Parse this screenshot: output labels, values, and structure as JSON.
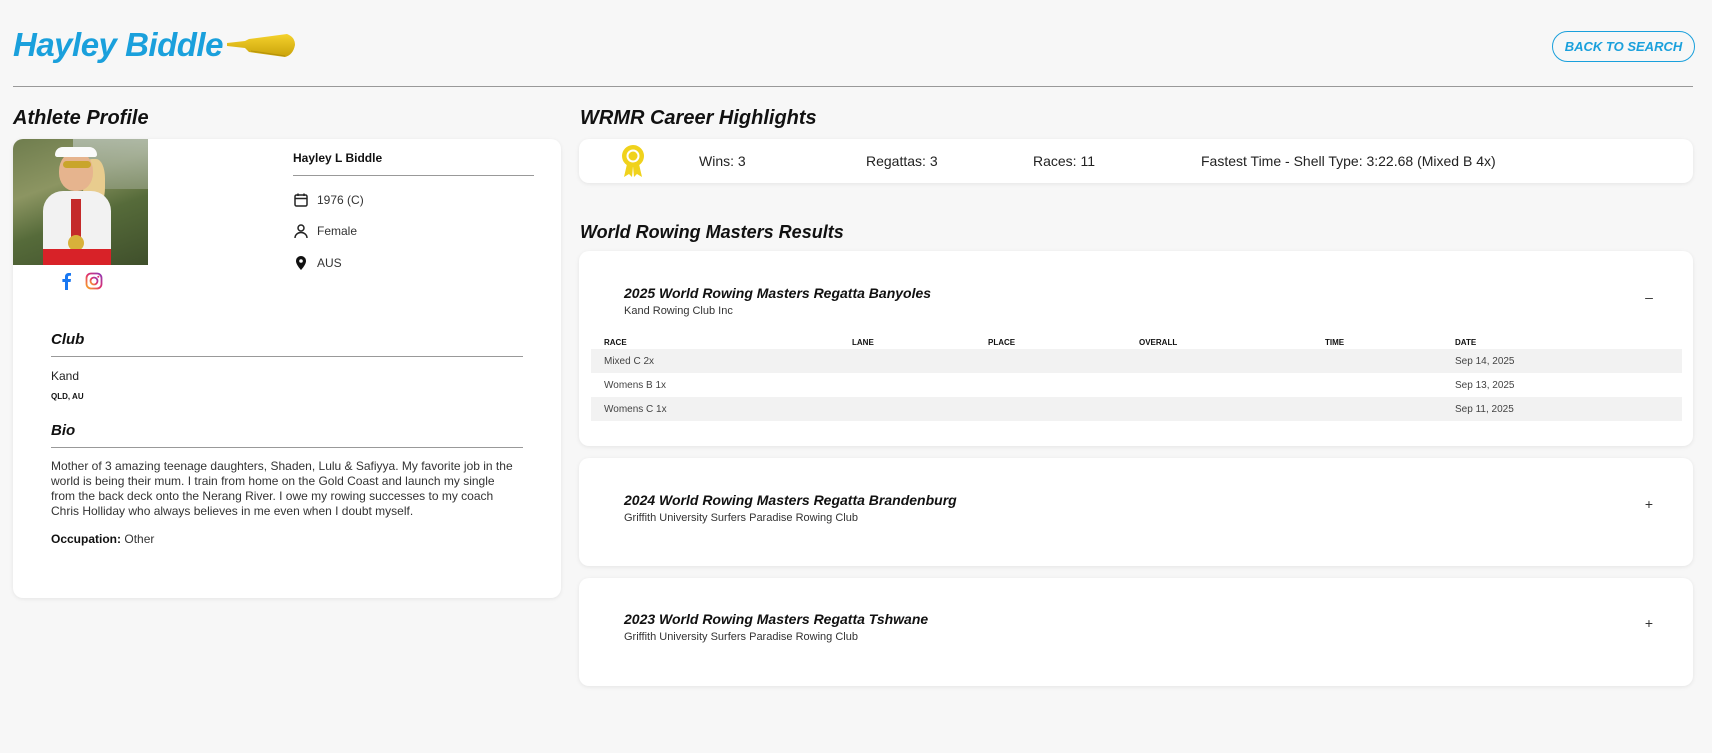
{
  "header": {
    "athlete_name": "Hayley Biddle",
    "back_button": "BACK TO SEARCH",
    "brand_color": "#1aa0dc"
  },
  "profile": {
    "section_title": "Athlete Profile",
    "full_name": "Hayley L Biddle",
    "birth": "1976 (C)",
    "gender": "Female",
    "country": "AUS",
    "icons": [
      "calendar-icon",
      "person-icon",
      "location-pin-icon",
      "facebook-icon",
      "instagram-icon"
    ],
    "club_title": "Club",
    "club_name": "Kand",
    "club_location": "QLD, AU",
    "bio_title": "Bio",
    "bio_text": "Mother of 3 amazing teenage daughters, Shaden, Lulu & Safiyya. My favorite job in the world is being their mum. I train from home on the Gold Coast and launch my single from the back deck onto the Nerang River. I owe my rowing successes to my coach Chris Holliday who always believes in me even when I doubt myself.",
    "occupation_label": "Occupation:",
    "occupation_value": "Other"
  },
  "highlights": {
    "section_title": "WRMR Career Highlights",
    "wins": "Wins:  3",
    "regattas": "Regattas:  3",
    "races": "Races:  11",
    "fastest": "Fastest Time - Shell Type: 3:22.68 (Mixed B 4x)"
  },
  "results": {
    "section_title": "World Rowing Masters Results",
    "columns": [
      "RACE",
      "LANE",
      "PLACE",
      "OVERALL",
      "TIME",
      "DATE"
    ],
    "regattas": [
      {
        "title": "2025 World Rowing Masters Regatta Banyoles",
        "club": "Kand Rowing Club Inc",
        "toggle": "–",
        "rows": [
          {
            "race": "Mixed C 2x",
            "lane": "",
            "place": "",
            "overall": "",
            "time": "",
            "date": "Sep 14, 2025"
          },
          {
            "race": "Womens B 1x",
            "lane": "",
            "place": "",
            "overall": "",
            "time": "",
            "date": "Sep 13, 2025"
          },
          {
            "race": "Womens C 1x",
            "lane": "",
            "place": "",
            "overall": "",
            "time": "",
            "date": "Sep 11, 2025"
          }
        ]
      },
      {
        "title": "2024 World Rowing Masters Regatta Brandenburg",
        "club": "Griffith University Surfers Paradise Rowing Club",
        "toggle": "+"
      },
      {
        "title": "2023 World Rowing Masters Regatta Tshwane",
        "club": "Griffith University Surfers Paradise Rowing Club",
        "toggle": "+"
      }
    ]
  }
}
